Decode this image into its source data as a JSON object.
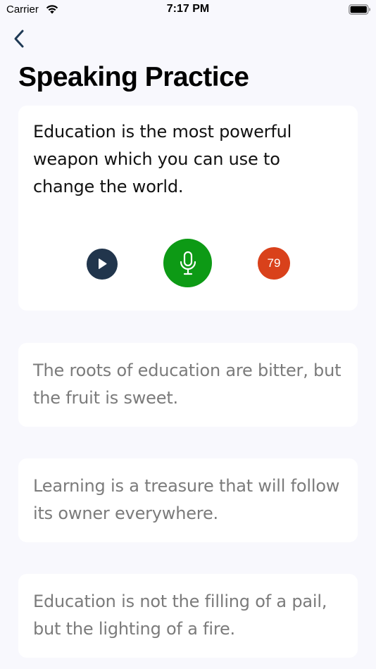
{
  "status_bar": {
    "carrier": "Carrier",
    "time": "7:17 PM"
  },
  "header": {
    "back_icon": "chevron-left-icon",
    "title": "Speaking Practice"
  },
  "phrases": [
    {
      "text": "Education is the most powerful weapon which you can use to change the world.",
      "active": true,
      "score": "79"
    },
    {
      "text": "The roots of education are bitter, but the fruit is sweet.",
      "active": false
    },
    {
      "text": "Learning is a treasure that will follow its owner everywhere.",
      "active": false
    },
    {
      "text": "Education is not the filling of a pail, but the lighting of a fire.",
      "active": false
    }
  ],
  "controls": {
    "play_icon": "play-icon",
    "mic_icon": "microphone-icon"
  },
  "colors": {
    "background": "#f8f8fd",
    "card": "#ffffff",
    "play_button": "#21354c",
    "mic_button": "#0d9a15",
    "score_badge": "#d9411b",
    "inactive_text": "#7b7b7b",
    "back_arrow": "#1f3a55"
  }
}
